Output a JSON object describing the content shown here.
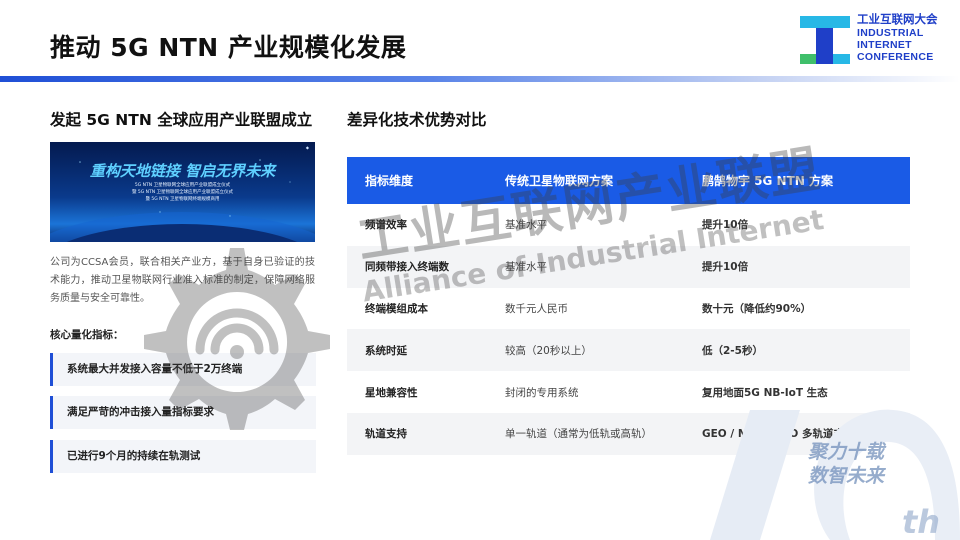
{
  "header": {
    "title": "推动 5G NTN 产业规模化发展"
  },
  "logo": {
    "cn": "工业互联网大会",
    "en_lines": [
      "INDUSTRIAL",
      "INTERNET",
      "CONFERENCE"
    ],
    "colors": {
      "blue": "#1f3fc8",
      "cyan": "#27b8e6",
      "green": "#3fbf6b"
    }
  },
  "left": {
    "heading": "发起 5G NTN 全球应用产业联盟成立",
    "banner": {
      "slogan": "重构天地链接 智启无界未来",
      "lines": [
        "5G NTN 卫星物联网全球应用产业联盟成立仪式",
        "暨 5G NTN 卫星物联网全球应用产业联盟成立仪式",
        "暨 5G NTN 卫星物联网终端规模商用"
      ]
    },
    "intro": "公司为CCSA会员，联合相关产业方，基于自身已验证的技术能力，推动卫星物联网行业准入标准的制定，保障网络服务质量与安全可靠性。",
    "metrics_label": "核心量化指标：",
    "metrics": [
      "系统最大并发接入容量不低于2万终端",
      "满足严苛的冲击接入量指标要求",
      "已进行9个月的持续在轨测试"
    ]
  },
  "right": {
    "heading": "差异化技术优势对比",
    "table": {
      "headers": [
        "指标维度",
        "传统卫星物联网方案",
        "鹏鹄物宇 5G NTN 方案"
      ],
      "rows": [
        [
          "频谱效率",
          "基准水平",
          "提升10倍"
        ],
        [
          "同频带接入终端数",
          "基准水平",
          "提升10倍"
        ],
        [
          "终端模组成本",
          "数千元人民币",
          "数十元（降低约90%）"
        ],
        [
          "系统时延",
          "较高（20秒以上）",
          "低（2-5秒）"
        ],
        [
          "星地兼容性",
          "封闭的专用系统",
          "复用地面5G NB-IoT 生态"
        ],
        [
          "轨道支持",
          "单一轨道（通常为低轨或高轨）",
          "GEO / MEO / LEO 多轨道支持"
        ]
      ]
    }
  },
  "watermark": {
    "cn": "工业互联网产业联盟",
    "en": "Alliance of Industrial Internet"
  },
  "decoration": {
    "slogan_lines": [
      "聚力十载",
      "数智未来"
    ],
    "suffix": "th"
  },
  "colors": {
    "accent": "#1f4fd6",
    "table_header": "#1a5be6"
  }
}
